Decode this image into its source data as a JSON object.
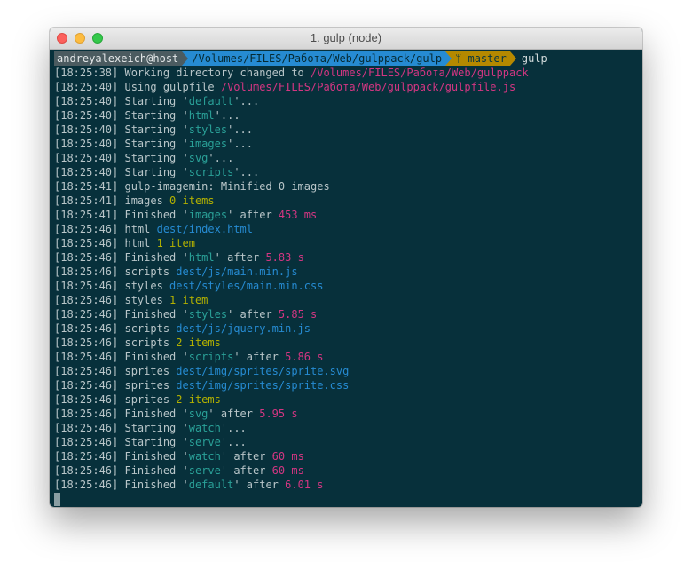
{
  "window": {
    "title": "1. gulp (node)"
  },
  "prompt": {
    "user": "andreyalexeich@host",
    "path": "/Volumes/FILES/Работа/Web/gulppack/gulp",
    "branch_icon": "git-branch-icon",
    "branch": "master",
    "command": "gulp"
  },
  "colors": {
    "background": "#07303b",
    "timestamp": "#b9c6c9",
    "path": "#d33682",
    "task": "#2aa198",
    "file": "#268bd2",
    "count": "#b3b100",
    "time": "#d33682"
  },
  "lines": [
    {
      "ts": "[18:25:38]",
      "parts": [
        {
          "t": "text",
          "v": " Working directory changed to "
        },
        {
          "t": "path",
          "v": "/Volumes/FILES/Работа/Web/gulppack"
        }
      ]
    },
    {
      "ts": "[18:25:40]",
      "parts": [
        {
          "t": "text",
          "v": " Using gulpfile "
        },
        {
          "t": "path",
          "v": "/Volumes/FILES/Работа/Web/gulppack/gulpfile.js"
        }
      ]
    },
    {
      "ts": "[18:25:40]",
      "parts": [
        {
          "t": "text",
          "v": " Starting "
        },
        {
          "t": "q",
          "v": "'"
        },
        {
          "t": "task",
          "v": "default"
        },
        {
          "t": "q",
          "v": "'"
        },
        {
          "t": "text",
          "v": "..."
        }
      ]
    },
    {
      "ts": "[18:25:40]",
      "parts": [
        {
          "t": "text",
          "v": " Starting "
        },
        {
          "t": "q",
          "v": "'"
        },
        {
          "t": "task",
          "v": "html"
        },
        {
          "t": "q",
          "v": "'"
        },
        {
          "t": "text",
          "v": "..."
        }
      ]
    },
    {
      "ts": "[18:25:40]",
      "parts": [
        {
          "t": "text",
          "v": " Starting "
        },
        {
          "t": "q",
          "v": "'"
        },
        {
          "t": "task",
          "v": "styles"
        },
        {
          "t": "q",
          "v": "'"
        },
        {
          "t": "text",
          "v": "..."
        }
      ]
    },
    {
      "ts": "[18:25:40]",
      "parts": [
        {
          "t": "text",
          "v": " Starting "
        },
        {
          "t": "q",
          "v": "'"
        },
        {
          "t": "task",
          "v": "images"
        },
        {
          "t": "q",
          "v": "'"
        },
        {
          "t": "text",
          "v": "..."
        }
      ]
    },
    {
      "ts": "[18:25:40]",
      "parts": [
        {
          "t": "text",
          "v": " Starting "
        },
        {
          "t": "q",
          "v": "'"
        },
        {
          "t": "task",
          "v": "svg"
        },
        {
          "t": "q",
          "v": "'"
        },
        {
          "t": "text",
          "v": "..."
        }
      ]
    },
    {
      "ts": "[18:25:40]",
      "parts": [
        {
          "t": "text",
          "v": " Starting "
        },
        {
          "t": "q",
          "v": "'"
        },
        {
          "t": "task",
          "v": "scripts"
        },
        {
          "t": "q",
          "v": "'"
        },
        {
          "t": "text",
          "v": "..."
        }
      ]
    },
    {
      "ts": "[18:25:41]",
      "parts": [
        {
          "t": "text",
          "v": " gulp-imagemin: Minified 0 images"
        }
      ]
    },
    {
      "ts": "[18:25:41]",
      "parts": [
        {
          "t": "text",
          "v": " images "
        },
        {
          "t": "count",
          "v": "0 items"
        }
      ]
    },
    {
      "ts": "[18:25:41]",
      "parts": [
        {
          "t": "text",
          "v": " Finished "
        },
        {
          "t": "q",
          "v": "'"
        },
        {
          "t": "task",
          "v": "images"
        },
        {
          "t": "q",
          "v": "'"
        },
        {
          "t": "text",
          "v": " after "
        },
        {
          "t": "time",
          "v": "453 ms"
        }
      ]
    },
    {
      "ts": "[18:25:46]",
      "parts": [
        {
          "t": "text",
          "v": " html "
        },
        {
          "t": "file",
          "v": "dest/index.html"
        }
      ]
    },
    {
      "ts": "[18:25:46]",
      "parts": [
        {
          "t": "text",
          "v": " html "
        },
        {
          "t": "count",
          "v": "1 item"
        }
      ]
    },
    {
      "ts": "[18:25:46]",
      "parts": [
        {
          "t": "text",
          "v": " Finished "
        },
        {
          "t": "q",
          "v": "'"
        },
        {
          "t": "task",
          "v": "html"
        },
        {
          "t": "q",
          "v": "'"
        },
        {
          "t": "text",
          "v": " after "
        },
        {
          "t": "time",
          "v": "5.83 s"
        }
      ]
    },
    {
      "ts": "[18:25:46]",
      "parts": [
        {
          "t": "text",
          "v": " scripts "
        },
        {
          "t": "file",
          "v": "dest/js/main.min.js"
        }
      ]
    },
    {
      "ts": "[18:25:46]",
      "parts": [
        {
          "t": "text",
          "v": " styles "
        },
        {
          "t": "file",
          "v": "dest/styles/main.min.css"
        }
      ]
    },
    {
      "ts": "[18:25:46]",
      "parts": [
        {
          "t": "text",
          "v": " styles "
        },
        {
          "t": "count",
          "v": "1 item"
        }
      ]
    },
    {
      "ts": "[18:25:46]",
      "parts": [
        {
          "t": "text",
          "v": " Finished "
        },
        {
          "t": "q",
          "v": "'"
        },
        {
          "t": "task",
          "v": "styles"
        },
        {
          "t": "q",
          "v": "'"
        },
        {
          "t": "text",
          "v": " after "
        },
        {
          "t": "time",
          "v": "5.85 s"
        }
      ]
    },
    {
      "ts": "[18:25:46]",
      "parts": [
        {
          "t": "text",
          "v": " scripts "
        },
        {
          "t": "file",
          "v": "dest/js/jquery.min.js"
        }
      ]
    },
    {
      "ts": "[18:25:46]",
      "parts": [
        {
          "t": "text",
          "v": " scripts "
        },
        {
          "t": "count",
          "v": "2 items"
        }
      ]
    },
    {
      "ts": "[18:25:46]",
      "parts": [
        {
          "t": "text",
          "v": " Finished "
        },
        {
          "t": "q",
          "v": "'"
        },
        {
          "t": "task",
          "v": "scripts"
        },
        {
          "t": "q",
          "v": "'"
        },
        {
          "t": "text",
          "v": " after "
        },
        {
          "t": "time",
          "v": "5.86 s"
        }
      ]
    },
    {
      "ts": "[18:25:46]",
      "parts": [
        {
          "t": "text",
          "v": " sprites "
        },
        {
          "t": "file",
          "v": "dest/img/sprites/sprite.svg"
        }
      ]
    },
    {
      "ts": "[18:25:46]",
      "parts": [
        {
          "t": "text",
          "v": " sprites "
        },
        {
          "t": "file",
          "v": "dest/img/sprites/sprite.css"
        }
      ]
    },
    {
      "ts": "[18:25:46]",
      "parts": [
        {
          "t": "text",
          "v": " sprites "
        },
        {
          "t": "count",
          "v": "2 items"
        }
      ]
    },
    {
      "ts": "[18:25:46]",
      "parts": [
        {
          "t": "text",
          "v": " Finished "
        },
        {
          "t": "q",
          "v": "'"
        },
        {
          "t": "task",
          "v": "svg"
        },
        {
          "t": "q",
          "v": "'"
        },
        {
          "t": "text",
          "v": " after "
        },
        {
          "t": "time",
          "v": "5.95 s"
        }
      ]
    },
    {
      "ts": "[18:25:46]",
      "parts": [
        {
          "t": "text",
          "v": " Starting "
        },
        {
          "t": "q",
          "v": "'"
        },
        {
          "t": "task",
          "v": "watch"
        },
        {
          "t": "q",
          "v": "'"
        },
        {
          "t": "text",
          "v": "..."
        }
      ]
    },
    {
      "ts": "[18:25:46]",
      "parts": [
        {
          "t": "text",
          "v": " Starting "
        },
        {
          "t": "q",
          "v": "'"
        },
        {
          "t": "task",
          "v": "serve"
        },
        {
          "t": "q",
          "v": "'"
        },
        {
          "t": "text",
          "v": "..."
        }
      ]
    },
    {
      "ts": "[18:25:46]",
      "parts": [
        {
          "t": "text",
          "v": " Finished "
        },
        {
          "t": "q",
          "v": "'"
        },
        {
          "t": "task",
          "v": "watch"
        },
        {
          "t": "q",
          "v": "'"
        },
        {
          "t": "text",
          "v": " after "
        },
        {
          "t": "time",
          "v": "60 ms"
        }
      ]
    },
    {
      "ts": "[18:25:46]",
      "parts": [
        {
          "t": "text",
          "v": " Finished "
        },
        {
          "t": "q",
          "v": "'"
        },
        {
          "t": "task",
          "v": "serve"
        },
        {
          "t": "q",
          "v": "'"
        },
        {
          "t": "text",
          "v": " after "
        },
        {
          "t": "time",
          "v": "60 ms"
        }
      ]
    },
    {
      "ts": "[18:25:46]",
      "parts": [
        {
          "t": "text",
          "v": " Finished "
        },
        {
          "t": "q",
          "v": "'"
        },
        {
          "t": "task",
          "v": "default"
        },
        {
          "t": "q",
          "v": "'"
        },
        {
          "t": "text",
          "v": " after "
        },
        {
          "t": "time",
          "v": "6.01 s"
        }
      ]
    }
  ]
}
